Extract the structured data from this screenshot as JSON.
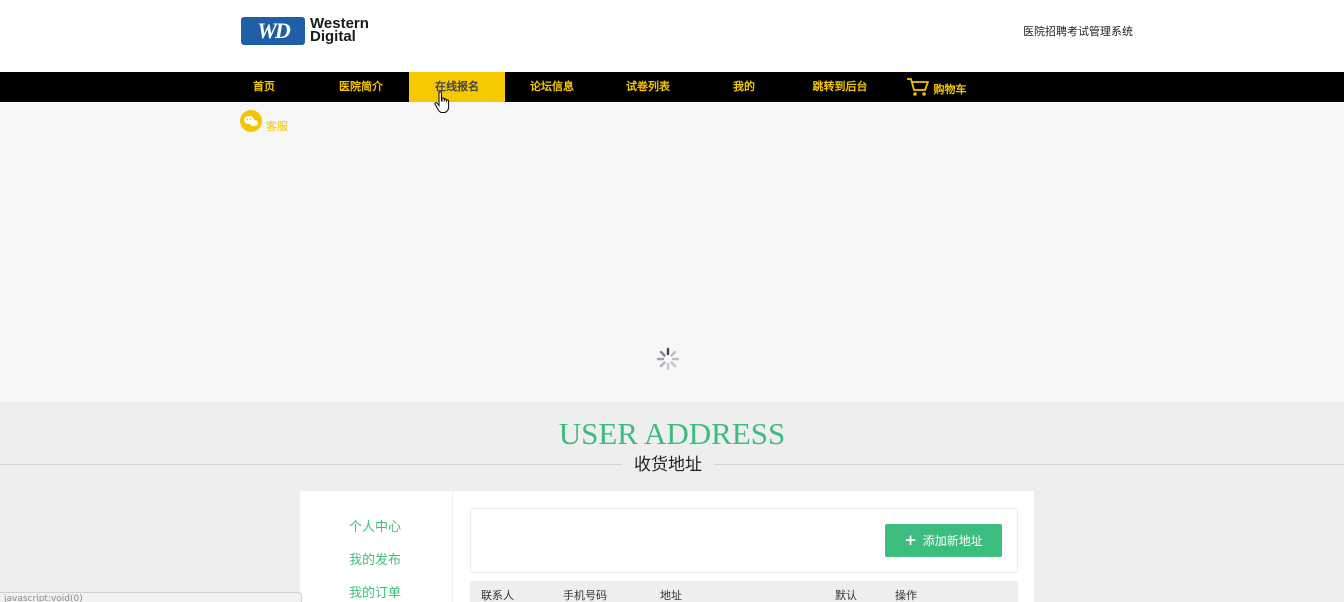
{
  "header": {
    "logo": {
      "badge": "WD",
      "line1": "Western",
      "line2": "Digital"
    },
    "site_title": "医院招聘考试管理系统"
  },
  "nav": {
    "items": [
      {
        "label": "首页"
      },
      {
        "label": "医院简介"
      },
      {
        "label": "在线报名",
        "active": true
      },
      {
        "label": "论坛信息"
      },
      {
        "label": "试卷列表"
      },
      {
        "label": "我的"
      },
      {
        "label": "跳转到后台"
      },
      {
        "label": "购物车"
      }
    ],
    "active_color": "#f6c800",
    "text_color": "#f2c500"
  },
  "kefu": {
    "label": "客服"
  },
  "section": {
    "title_en": "USER ADDRESS",
    "title_cn": "收货地址",
    "accent_color": "#3dbd7d"
  },
  "sidebar": {
    "items": [
      {
        "label": "个人中心"
      },
      {
        "label": "我的发布"
      },
      {
        "label": "我的订单"
      }
    ]
  },
  "toolbar": {
    "add_label": "添加新地址"
  },
  "table": {
    "columns": [
      "联系人",
      "手机号码",
      "地址",
      "默认",
      "操作"
    ]
  },
  "statusbar": {
    "text": "javascript:void(0)"
  }
}
